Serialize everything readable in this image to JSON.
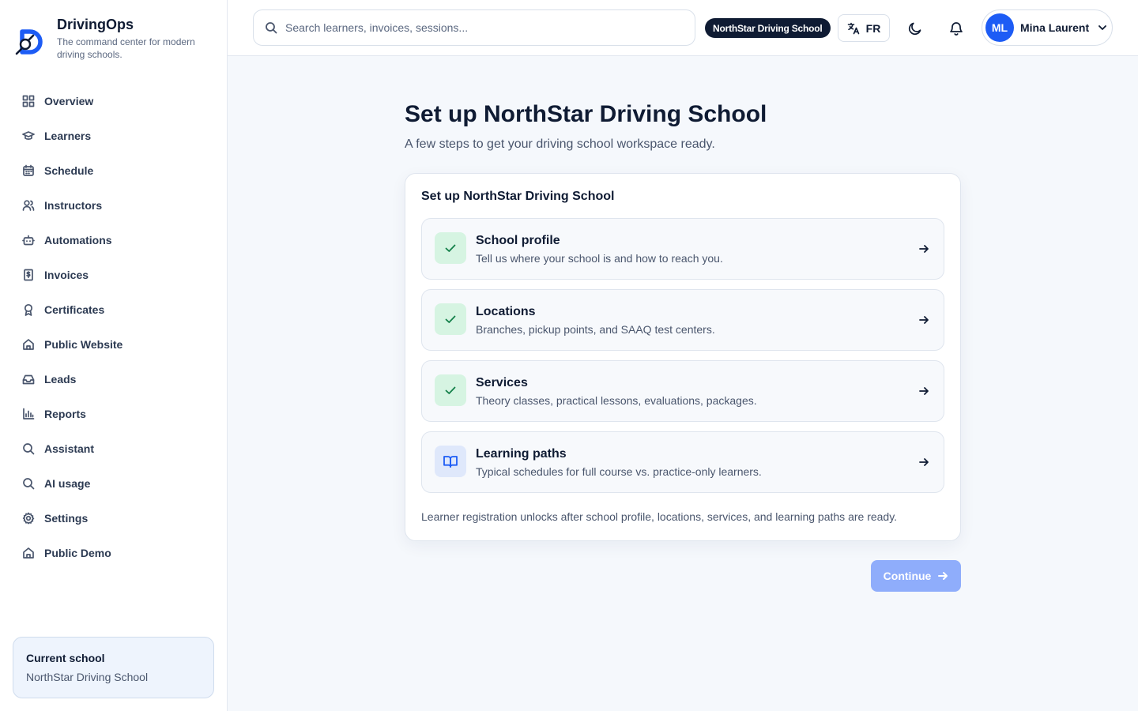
{
  "brand": {
    "name": "DrivingOps",
    "tagline": "The command center for modern driving schools."
  },
  "sidebar": {
    "items": [
      {
        "label": "Overview",
        "icon": "grid-icon"
      },
      {
        "label": "Learners",
        "icon": "graduation-cap-icon"
      },
      {
        "label": "Schedule",
        "icon": "calendar-icon"
      },
      {
        "label": "Instructors",
        "icon": "users-icon"
      },
      {
        "label": "Automations",
        "icon": "bot-icon"
      },
      {
        "label": "Invoices",
        "icon": "invoice-icon"
      },
      {
        "label": "Certificates",
        "icon": "award-icon"
      },
      {
        "label": "Public Website",
        "icon": "home-icon"
      },
      {
        "label": "Leads",
        "icon": "inbox-icon"
      },
      {
        "label": "Reports",
        "icon": "bar-chart-icon"
      },
      {
        "label": "Assistant",
        "icon": "search-icon"
      },
      {
        "label": "AI usage",
        "icon": "search-icon"
      },
      {
        "label": "Settings",
        "icon": "gear-icon"
      },
      {
        "label": "Public Demo",
        "icon": "home-icon"
      }
    ],
    "current_school": {
      "label": "Current school",
      "value": "NorthStar Driving School"
    }
  },
  "header": {
    "search_placeholder": "Search learners, invoices, sessions...",
    "school_badge": "NorthStar Driving School",
    "language": "FR",
    "user": {
      "initials": "ML",
      "name": "Mina Laurent"
    }
  },
  "main": {
    "title": "Set up NorthStar Driving School",
    "subtitle": "A few steps to get your driving school workspace ready.",
    "card": {
      "title": "Set up NorthStar Driving School",
      "steps": [
        {
          "title": "School profile",
          "description": "Tell us where your school is and how to reach you.",
          "status": "done"
        },
        {
          "title": "Locations",
          "description": "Branches, pickup points, and SAAQ test centers.",
          "status": "done"
        },
        {
          "title": "Services",
          "description": "Theory classes, practical lessons, evaluations, packages.",
          "status": "done"
        },
        {
          "title": "Learning paths",
          "description": "Typical schedules for full course vs. practice-only learners.",
          "status": "todo"
        }
      ],
      "note": "Learner registration unlocks after school profile, locations, services, and learning paths are ready."
    },
    "continue_label": "Continue"
  },
  "colors": {
    "accent": "#1d5cf5",
    "accent_disabled": "#8fadfb",
    "success_bg": "#d6f4e2",
    "success": "#14804a",
    "ink": "#0f1b33"
  }
}
